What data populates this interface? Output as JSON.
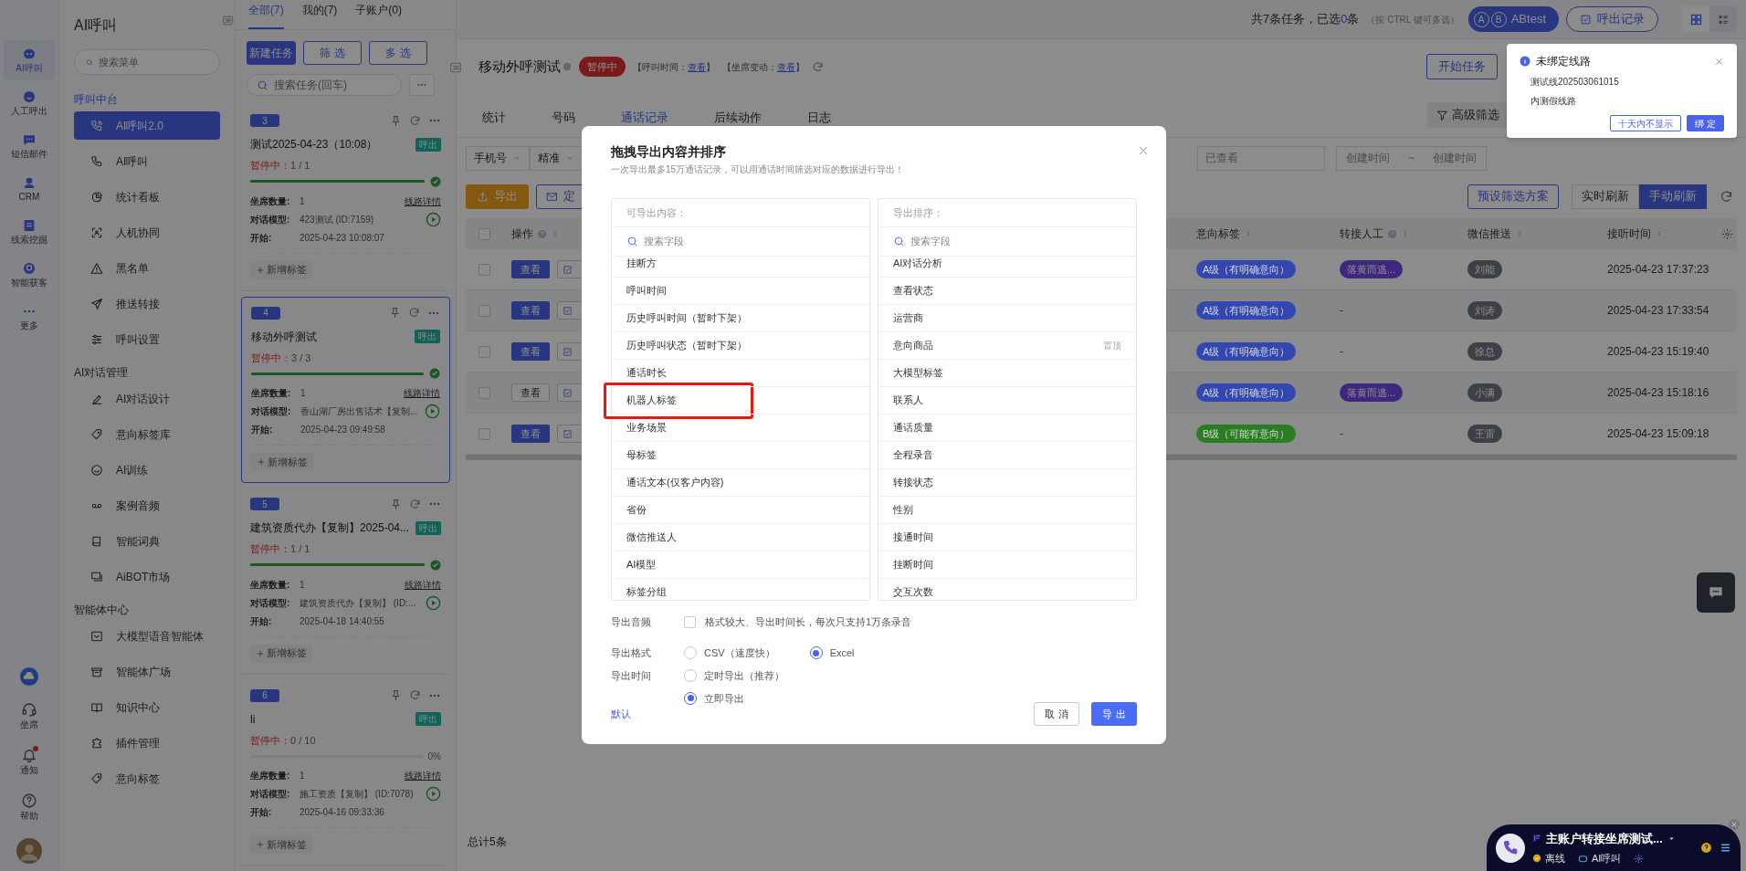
{
  "rail": {
    "items": [
      {
        "label": "AI呼叫",
        "selected": true
      },
      {
        "label": "人工呼出",
        "selected": false
      },
      {
        "label": "短信邮件",
        "selected": false
      },
      {
        "label": "CRM",
        "selected": false
      },
      {
        "label": "线索挖掘",
        "selected": false
      },
      {
        "label": "智能获客",
        "selected": false
      },
      {
        "label": "更多",
        "selected": false
      }
    ],
    "bottom": [
      {
        "label": "坐席",
        "badge": false
      },
      {
        "label": "通知",
        "badge": true
      },
      {
        "label": "帮助",
        "badge": false
      }
    ]
  },
  "menu": {
    "title": "AI呼叫",
    "search_placeholder": "搜索菜单",
    "sections": [
      {
        "title": "呼叫中台",
        "accent": true,
        "items": [
          {
            "label": "AI呼叫2.0",
            "selected": true
          },
          {
            "label": "AI呼叫",
            "selected": false
          },
          {
            "label": "统计看板",
            "selected": false
          },
          {
            "label": "人机协同",
            "selected": false
          },
          {
            "label": "黑名单",
            "selected": false
          },
          {
            "label": "推送转接",
            "selected": false
          },
          {
            "label": "呼叫设置",
            "selected": false
          }
        ]
      },
      {
        "title": "AI对话管理",
        "accent": false,
        "items": [
          {
            "label": "AI对话设计",
            "selected": false
          },
          {
            "label": "意向标签库",
            "selected": false
          },
          {
            "label": "AI训练",
            "selected": false
          },
          {
            "label": "案例音频",
            "selected": false
          },
          {
            "label": "智能词典",
            "selected": false
          },
          {
            "label": "AiBOT市场",
            "selected": false
          }
        ]
      },
      {
        "title": "智能体中心",
        "accent": false,
        "items": [
          {
            "label": "大模型语音智能体",
            "selected": false
          },
          {
            "label": "智能体广场",
            "selected": false
          },
          {
            "label": "知识中心",
            "selected": false
          },
          {
            "label": "插件管理",
            "selected": false
          },
          {
            "label": "意向标签",
            "selected": false
          }
        ]
      }
    ]
  },
  "task_panel": {
    "tabs": [
      {
        "label": "全部(7)",
        "selected": true
      },
      {
        "label": "我的(7)",
        "selected": false
      },
      {
        "label": "子账户(0)",
        "selected": false
      }
    ],
    "buttons": [
      {
        "label": "新建任务",
        "kind": "primary"
      },
      {
        "label": "筛 选",
        "kind": "outline"
      },
      {
        "label": "多 选",
        "kind": "outline"
      }
    ],
    "search_placeholder": "搜索任务(回车)",
    "tasks": [
      {
        "number": "3",
        "title": "测试2025-04-23（10:08）",
        "tag": "呼出",
        "status": "暂停中：",
        "progress": "1 / 1",
        "level": 1,
        "done": true,
        "seats_label": "坐席数量:",
        "seats": "1",
        "route_link": "线路详情",
        "model_label": "对话模型:",
        "model": "423测试 (ID:7159)",
        "start_label": "开始:",
        "start": "2025-04-23 10:08:07",
        "add_tag": "新增标签",
        "selected": false
      },
      {
        "number": "4",
        "title": "移动外呼测试",
        "tag": "呼出",
        "status": "暂停中：",
        "progress": "3 / 3",
        "level": 1,
        "done": true,
        "seats_label": "坐席数量:",
        "seats": "1",
        "route_link": "线路详情",
        "model_label": "对话模型:",
        "model": "香山湖厂房出售话术【复制...",
        "start_label": "开始:",
        "start": "2025-04-23 09:49:58",
        "add_tag": "新增标签",
        "selected": true
      },
      {
        "number": "5",
        "title": "建筑资质代办【复制】2025-04...",
        "tag": "呼出",
        "status": "暂停中：",
        "progress": "1 / 1",
        "level": 1,
        "done": true,
        "seats_label": "坐席数量:",
        "seats": "1",
        "route_link": "线路详情",
        "model_label": "对话模型:",
        "model": "建筑资质代办【复制】 (ID:...",
        "start_label": "开始:",
        "start": "2025-04-18 14:40:55",
        "add_tag": "新增标签",
        "selected": false
      },
      {
        "number": "6",
        "title": "li",
        "tag": "呼出",
        "status": "暂停中：",
        "progress": "0 / 10",
        "level": 0,
        "done": false,
        "percent": "0%",
        "seats_label": "坐席数量:",
        "seats": "1",
        "route_link": "线路详情",
        "model_label": "对话模型:",
        "model": "施工资质【复制】 (ID:7078)",
        "start_label": "开始:",
        "start": "2025-04-16 09:33:36",
        "add_tag": "新增标签",
        "selected": false
      }
    ]
  },
  "topbar": {
    "summary_prefix": "共7条任务，已选",
    "selected_count": "0",
    "summary_suffix": "条",
    "hint": "（按 CTRL 键可多选）",
    "ab_letters": [
      "A",
      "B"
    ],
    "ab_label": "ABtest",
    "records_button": "呼出记录",
    "views": [
      {
        "kind": "grid",
        "selected": true
      },
      {
        "kind": "list",
        "selected": false
      }
    ]
  },
  "header": {
    "title": "移动外呼测试",
    "status": "暂停中",
    "links": [
      {
        "before": "【呼叫时间：",
        "link": "查看",
        "after": "】"
      },
      {
        "before": "【坐席变动：",
        "link": "查看",
        "after": "】"
      }
    ],
    "start_button": "开始任务"
  },
  "tabs": [
    {
      "label": "统计",
      "selected": false
    },
    {
      "label": "号码",
      "selected": false
    },
    {
      "label": "通话记录",
      "selected": true
    },
    {
      "label": "后续动作",
      "selected": false
    },
    {
      "label": "日志",
      "selected": false
    }
  ],
  "advanced_filter": "高级筛选",
  "filters": {
    "phone_type": "手机号",
    "match": "精准",
    "viewed_placeholder": "已查看",
    "date_start": "创建时间",
    "date_sep": "~",
    "date_end": "创建时间"
  },
  "actions": {
    "export": "导出",
    "schedule": "定",
    "preset": "预设筛选方案",
    "refresh_modes": [
      {
        "label": "实时刷新",
        "selected": false
      },
      {
        "label": "手动刷新",
        "selected": true
      }
    ]
  },
  "table": {
    "all_checked": false,
    "columns": [
      {
        "label": "操作",
        "help": true
      },
      {
        "label": "意向标签",
        "help": false
      },
      {
        "label": "转接人工",
        "help": true
      },
      {
        "label": "微信推送",
        "help": false
      },
      {
        "label": "接听时间",
        "help": false
      }
    ],
    "rows": [
      {
        "checked": false,
        "view": {
          "label": "查看",
          "kind": "primary"
        },
        "intent": {
          "label": "A级（有明确意向）",
          "color": "#3347b0"
        },
        "transfer": {
          "label": "落黄而逃...",
          "kind": "tag"
        },
        "wechat": "刘能",
        "time": "2025-04-23 17:37:23"
      },
      {
        "checked": false,
        "view": {
          "label": "查看",
          "kind": "primary"
        },
        "intent": {
          "label": "A级（有明确意向）",
          "color": "#3347b0"
        },
        "transfer": {
          "label": "-",
          "kind": "text"
        },
        "wechat": "刘涛",
        "time": "2025-04-23 17:33:54"
      },
      {
        "checked": false,
        "view": {
          "label": "查看",
          "kind": "primary"
        },
        "intent": {
          "label": "A级（有明确意向）",
          "color": "#3347b0"
        },
        "transfer": {
          "label": "-",
          "kind": "text"
        },
        "wechat": "徐总",
        "time": "2025-04-23 15:19:40"
      },
      {
        "checked": false,
        "view": {
          "label": "查看",
          "kind": "plain"
        },
        "intent": {
          "label": "A级（有明确意向）",
          "color": "#3347b0"
        },
        "transfer": {
          "label": "落黄而逃...",
          "kind": "tag"
        },
        "wechat": "小满",
        "time": "2025-04-23 15:18:16"
      },
      {
        "checked": false,
        "view": {
          "label": "查看",
          "kind": "primary"
        },
        "intent": {
          "label": "B级（可能有意向）",
          "color": "#2a7d22"
        },
        "transfer": {
          "label": "-",
          "kind": "text"
        },
        "wechat": "王雷",
        "time": "2025-04-23 15:09:18"
      }
    ]
  },
  "footer": "总计5条",
  "modal": {
    "title": "拖拽导出内容并排序",
    "subtitle": "一次导出最多15万通话记录，可以用通话时间筛选对应的数据进行导出！",
    "lists": [
      {
        "header": "可导出内容：",
        "search_placeholder": "搜索字段",
        "items": [
          {
            "label": "挂断方",
            "highlighted": false
          },
          {
            "label": "呼叫时间",
            "highlighted": false
          },
          {
            "label": "历史呼叫时间（暂时下架）",
            "highlighted": false
          },
          {
            "label": "历史呼叫状态（暂时下架）",
            "highlighted": false
          },
          {
            "label": "通话时长",
            "highlighted": false
          },
          {
            "label": "机器人标签",
            "highlighted": true
          },
          {
            "label": "业务场景",
            "highlighted": false
          },
          {
            "label": "母标签",
            "highlighted": false
          },
          {
            "label": "通话文本(仅客户内容)",
            "highlighted": false
          },
          {
            "label": "省份",
            "highlighted": false
          },
          {
            "label": "微信推送人",
            "highlighted": false
          },
          {
            "label": "AI模型",
            "highlighted": false
          },
          {
            "label": "标签分组",
            "highlighted": false
          }
        ]
      },
      {
        "header": "导出排序：",
        "search_placeholder": "搜索字段",
        "items": [
          {
            "label": "AI对话分析",
            "highlighted": false
          },
          {
            "label": "查看状态",
            "highlighted": false
          },
          {
            "label": "运营商",
            "highlighted": false
          },
          {
            "label": "意向商品",
            "highlighted": false,
            "hint": "置顶"
          },
          {
            "label": "大模型标签",
            "highlighted": false
          },
          {
            "label": "联系人",
            "highlighted": false
          },
          {
            "label": "通话质量",
            "highlighted": false
          },
          {
            "label": "全程录音",
            "highlighted": false
          },
          {
            "label": "转接状态",
            "highlighted": false
          },
          {
            "label": "性别",
            "highlighted": false
          },
          {
            "label": "接通时间",
            "highlighted": false
          },
          {
            "label": "挂断时间",
            "highlighted": false
          },
          {
            "label": "交互次数",
            "highlighted": false
          }
        ]
      }
    ],
    "audio": {
      "label": "导出音频",
      "checked": false,
      "text": "格式较大、导出时间长，每次只支持1万条录音"
    },
    "format": {
      "label": "导出格式",
      "options": [
        {
          "label": "CSV（速度快）",
          "selected": false
        },
        {
          "label": "Excel",
          "selected": true
        }
      ]
    },
    "timing": {
      "label": "导出时间",
      "options": [
        {
          "label": "定时导出（推荐）",
          "selected": false
        },
        {
          "label": "立即导出",
          "selected": true
        }
      ]
    },
    "default_link": "默认",
    "cancel": "取 消",
    "confirm": "导 出"
  },
  "notification": {
    "title": "未绑定线路",
    "lines": [
      "测试线202503061015",
      "内测假线路"
    ],
    "buttons": [
      {
        "label": "十天内不显示",
        "kind": "outline"
      },
      {
        "label": "绑 定",
        "kind": "primary"
      }
    ]
  },
  "call_widget": {
    "name": "主账户转接坐席测试...",
    "status": "离线",
    "mode": "AI呼叫"
  }
}
